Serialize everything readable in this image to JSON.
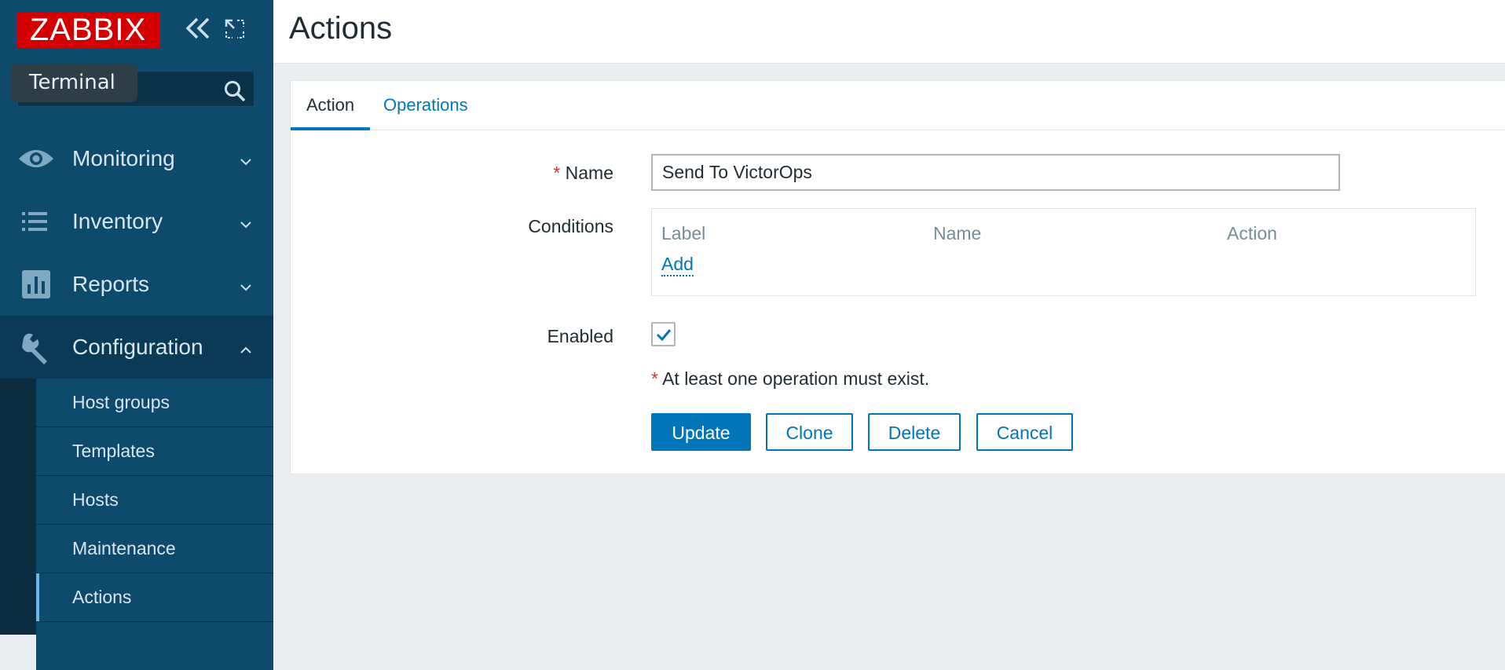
{
  "brand": {
    "logo_text": "ZABBIX",
    "accent": "#d40000"
  },
  "sidebar": {
    "tooltip": "Terminal",
    "search": {
      "placeholder": "",
      "icon": "search-icon"
    },
    "menu": [
      {
        "label": "Monitoring",
        "icon": "eye-icon",
        "expanded": false
      },
      {
        "label": "Inventory",
        "icon": "list-icon",
        "expanded": false
      },
      {
        "label": "Reports",
        "icon": "bar-chart-icon",
        "expanded": false
      },
      {
        "label": "Configuration",
        "icon": "wrench-icon",
        "expanded": true
      }
    ],
    "submenu": [
      {
        "label": "Host groups"
      },
      {
        "label": "Templates"
      },
      {
        "label": "Hosts"
      },
      {
        "label": "Maintenance"
      },
      {
        "label": "Actions",
        "selected": true
      }
    ]
  },
  "header": {
    "title": "Actions"
  },
  "tabs": [
    {
      "label": "Action",
      "active": true
    },
    {
      "label": "Operations",
      "active": false
    }
  ],
  "form": {
    "name_label": "Name",
    "required_mark": "*",
    "name_value": "Send To VictorOps",
    "conditions_label": "Conditions",
    "conditions_columns": [
      "Label",
      "Name",
      "Action"
    ],
    "conditions_add": "Add",
    "enabled_label": "Enabled",
    "enabled": true,
    "note": "At least one operation must exist.",
    "buttons": {
      "update": "Update",
      "clone": "Clone",
      "delete": "Delete",
      "cancel": "Cancel"
    }
  }
}
